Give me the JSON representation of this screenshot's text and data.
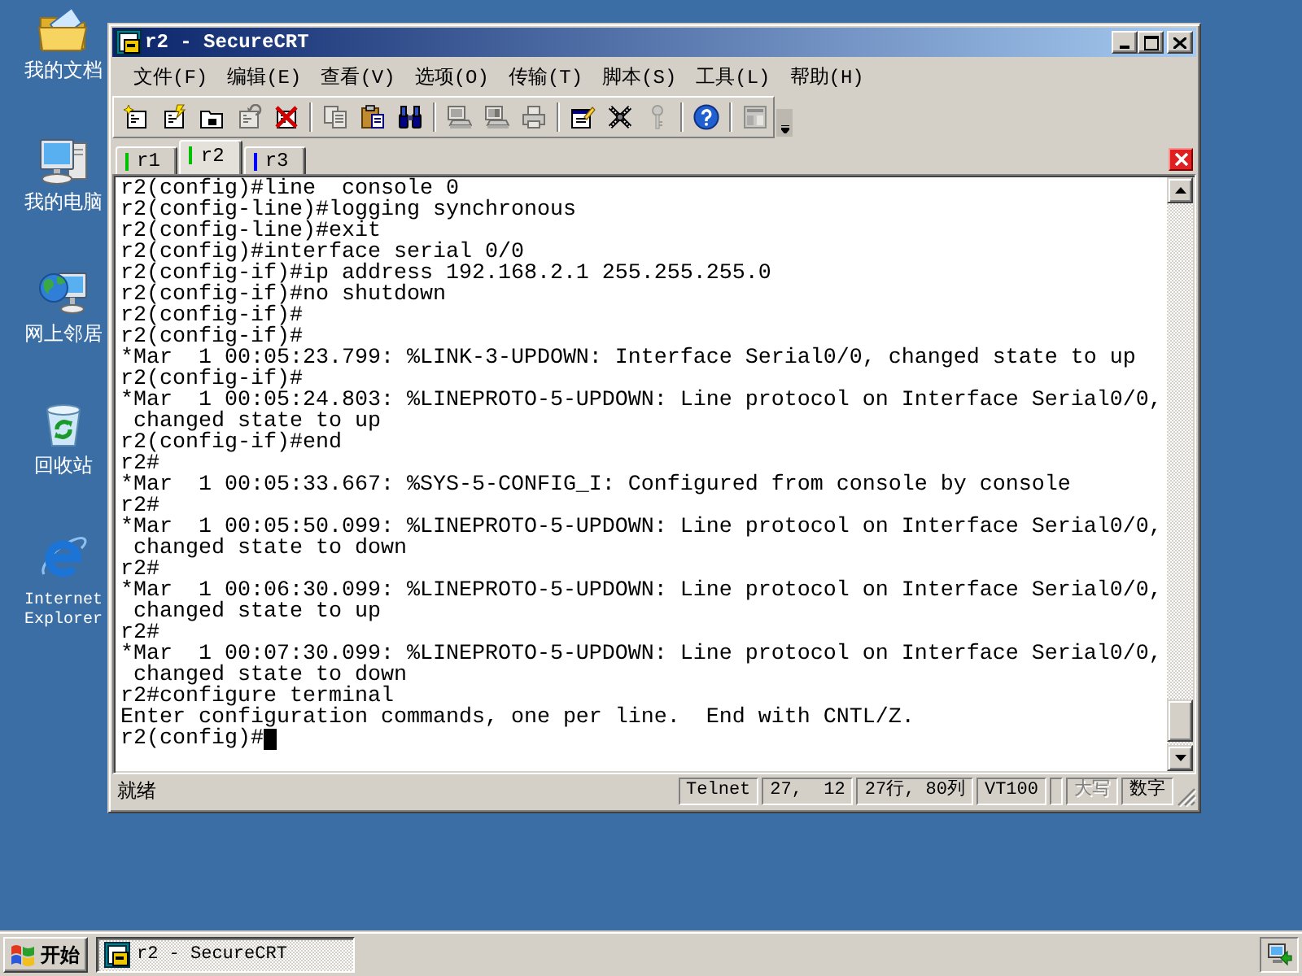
{
  "desktop_icons": [
    {
      "label": "我的文档",
      "kind": "documents"
    },
    {
      "label": "我的电脑",
      "kind": "computer"
    },
    {
      "label": "网上邻居",
      "kind": "network"
    },
    {
      "label": "回收站",
      "kind": "recyclebin"
    },
    {
      "label": "Internet Explorer",
      "kind": "browser"
    }
  ],
  "window": {
    "title": "r2 - SecureCRT"
  },
  "menu": [
    "文件(F)",
    "编辑(E)",
    "查看(V)",
    "选项(O)",
    "传输(T)",
    "脚本(S)",
    "工具(L)",
    "帮助(H)"
  ],
  "toolbar_groups": [
    [
      {
        "kind": "quickconnect",
        "disabled": false
      },
      {
        "kind": "connect",
        "disabled": false
      },
      {
        "kind": "tabconnect",
        "disabled": false
      },
      {
        "kind": "reconnect",
        "disabled": true
      },
      {
        "kind": "disconnect",
        "disabled": false
      }
    ],
    [
      {
        "kind": "copy",
        "disabled": true
      },
      {
        "kind": "paste",
        "disabled": false
      },
      {
        "kind": "find",
        "disabled": false
      }
    ],
    [
      {
        "kind": "printscreen",
        "disabled": true
      },
      {
        "kind": "printselection",
        "disabled": true
      },
      {
        "kind": "print",
        "disabled": true
      }
    ],
    [
      {
        "kind": "options",
        "disabled": false
      },
      {
        "kind": "global",
        "disabled": false
      },
      {
        "kind": "keygen",
        "disabled": true
      }
    ],
    [
      {
        "kind": "help",
        "disabled": false
      }
    ],
    [
      {
        "kind": "tile",
        "disabled": true
      }
    ]
  ],
  "tabs": [
    {
      "label": "r1",
      "selected": false,
      "color": "#00c000"
    },
    {
      "label": "r2",
      "selected": true,
      "color": "#00c000"
    },
    {
      "label": "r3",
      "selected": false,
      "color": "#0000ff"
    }
  ],
  "terminal": {
    "lines": [
      "r2(config)#line  console 0",
      "r2(config-line)#logging synchronous",
      "r2(config-line)#exit",
      "r2(config)#interface serial 0/0",
      "r2(config-if)#ip address 192.168.2.1 255.255.255.0",
      "r2(config-if)#no shutdown",
      "r2(config-if)#",
      "r2(config-if)#",
      "*Mar  1 00:05:23.799: %LINK-3-UPDOWN: Interface Serial0/0, changed state to up",
      "r2(config-if)#",
      "*Mar  1 00:05:24.803: %LINEPROTO-5-UPDOWN: Line protocol on Interface Serial0/0,",
      " changed state to up",
      "r2(config-if)#end",
      "r2#",
      "*Mar  1 00:05:33.667: %SYS-5-CONFIG_I: Configured from console by console",
      "r2#",
      "*Mar  1 00:05:50.099: %LINEPROTO-5-UPDOWN: Line protocol on Interface Serial0/0,",
      " changed state to down",
      "r2#",
      "*Mar  1 00:06:30.099: %LINEPROTO-5-UPDOWN: Line protocol on Interface Serial0/0,",
      " changed state to up",
      "r2#",
      "*Mar  1 00:07:30.099: %LINEPROTO-5-UPDOWN: Line protocol on Interface Serial0/0,",
      " changed state to down",
      "r2#configure terminal",
      "Enter configuration commands, one per line.  End with CNTL/Z.",
      "r2(config)#"
    ]
  },
  "status_bar": {
    "message": "就绪",
    "info": [
      "Telnet",
      "27,  12",
      "27行, 80列",
      "VT100"
    ],
    "keys": [
      {
        "label": "大写",
        "on": false
      },
      {
        "label": "数字",
        "on": true
      }
    ]
  },
  "taskbar": {
    "start": "开始",
    "tasks": [
      {
        "label": "r2 - SecureCRT",
        "selected": true
      }
    ]
  }
}
